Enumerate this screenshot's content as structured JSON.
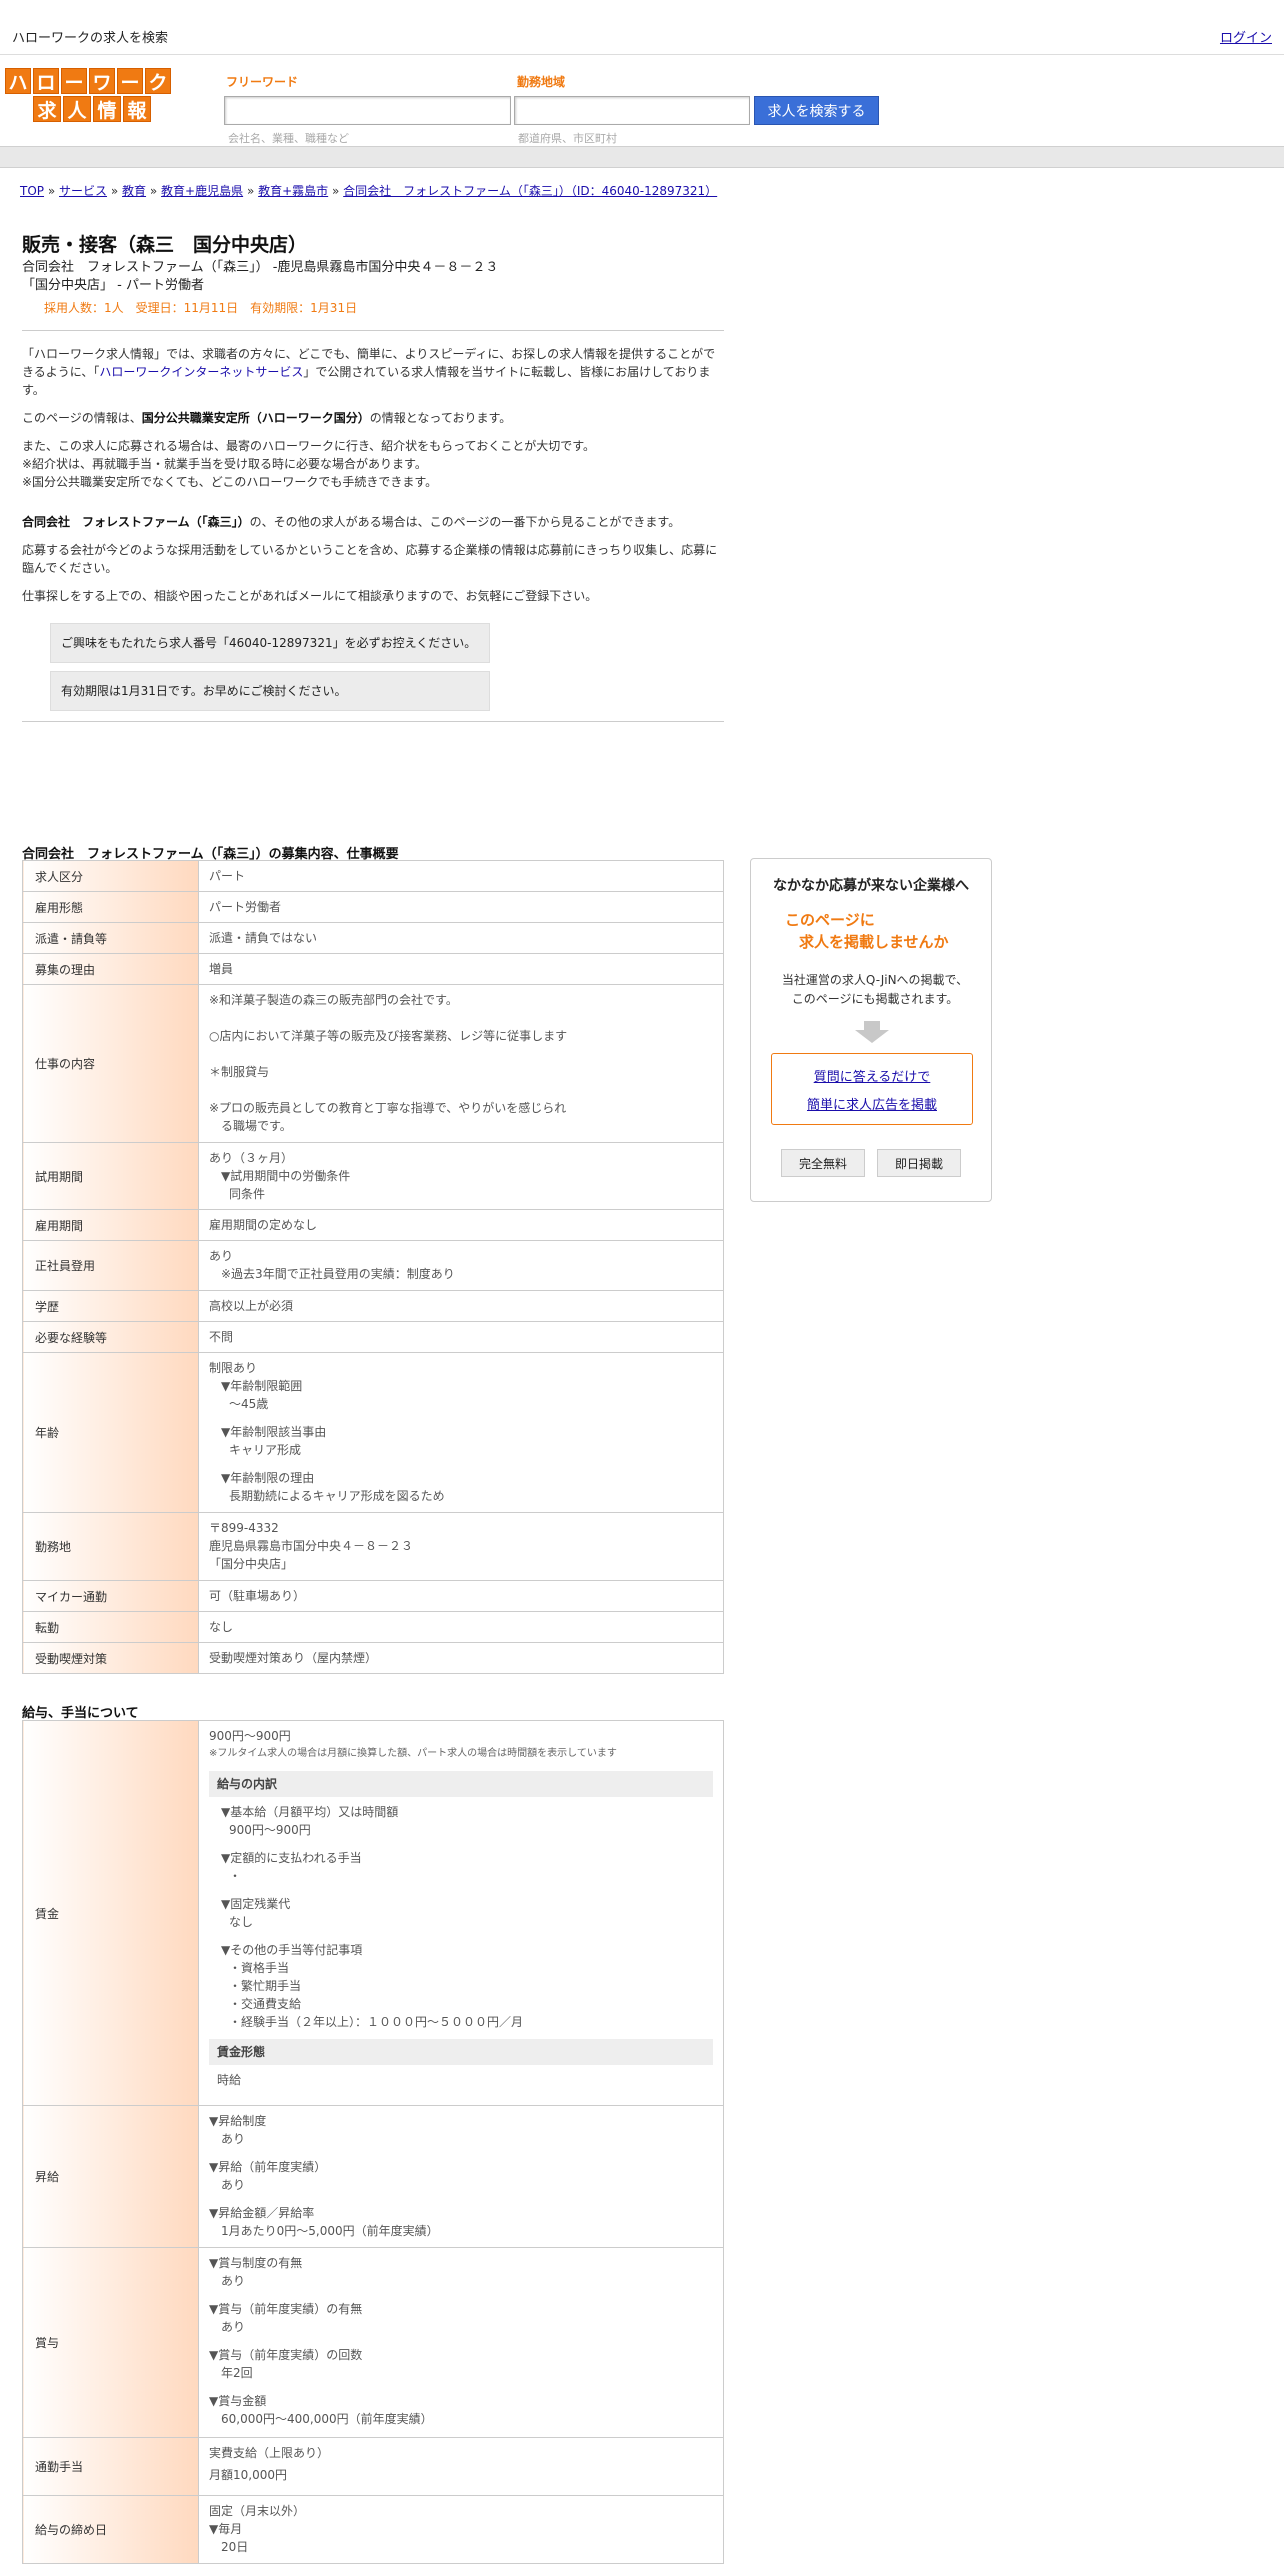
{
  "topbar": {
    "site_title": "ハローワークの求人を検索",
    "login": "ログイン"
  },
  "logo": {
    "row1": [
      "ハ",
      "ロ",
      "ー",
      "ワ",
      "ー",
      "ク"
    ],
    "row2": [
      "求",
      "人",
      "情",
      "報"
    ]
  },
  "search": {
    "keyword_label": "フリーワード",
    "keyword_placeholder": "",
    "keyword_hint": "会社名、業種、職種など",
    "area_label": "勤務地域",
    "area_hint": "都道府県、市区町村",
    "button": "求人を検索する"
  },
  "breadcrumb": [
    "TOP",
    "サービス",
    "教育",
    "教育+鹿児島県",
    "教育+霧島市",
    "合同会社　フォレストファーム（「森三」）（ID：46040-12897321）"
  ],
  "breadcrumb_sep": "»",
  "job": {
    "title": "販売・接客（森三　国分中央店）",
    "company_line": "合同会社　フォレストファーム（「森三」） -鹿児島県霧島市国分中央４－８－２３",
    "store_line": "「国分中央店」 - パート労働者",
    "meta": "採用人数：1人　受理日：11月11日　有効期限：1月31日"
  },
  "intro": {
    "p1_a": "「ハローワーク求人情報」では、求職者の方々に、どこでも、簡単に、よりスピーディに、お探しの求人情報を提供することができるように、「",
    "p1_link": "ハローワークインターネットサービス",
    "p1_b": "」で公開されている求人情報を当サイトに転載し、皆様にお届けしております。",
    "p2_a": "このページの情報は、",
    "p2_b": "国分公共職業安定所（ハローワーク国分）",
    "p2_c": "の情報となっております。",
    "p3_1": "また、この求人に応募される場合は、最寄のハローワークに行き、紹介状をもらっておくことが大切です。",
    "p3_2": "※紹介状は、再就職手当・就業手当を受け取る時に必要な場合があります。",
    "p3_3": "※国分公共職業安定所でなくても、どこのハローワークでも手続きできます。",
    "p4_a": "合同会社　フォレストファーム（「森三」）",
    "p4_b": "の、その他の求人がある場合は、このページの一番下から見ることができます。",
    "p5": "応募する会社が今どのような採用活動をしているかということを含め、応募する企業様の情報は応募前にきっちり収集し、応募に臨んでください。",
    "p6": "仕事探しをする上での、相談や困ったことがあればメールにて相談承りますので、お気軽にご登録下さい。",
    "notice1": "ご興味をもたれたら求人番号「46040-12897321」を必ずお控えください。",
    "notice2": "有効期限は1月31日です。お早めにご検討ください。"
  },
  "section1": {
    "title": "合同会社　フォレストファーム（「森三」）の募集内容、仕事概要",
    "rows": {
      "kubun": {
        "label": "求人区分",
        "value": "パート"
      },
      "keitai": {
        "label": "雇用形態",
        "value": "パート労働者"
      },
      "haken": {
        "label": "派遣・請負等",
        "value": "派遣・請負ではない"
      },
      "riyu": {
        "label": "募集の理由",
        "value": "増員"
      },
      "naiyo": {
        "label": "仕事の内容",
        "l1": "※和洋菓子製造の森三の販売部門の会社です。",
        "l2": "○店内において洋菓子等の販売及び接客業務、レジ等に従事します",
        "l3": "＊制服貸与",
        "l4": "※プロの販売員としての教育と丁寧な指導で、やりがいを感じられ",
        "l5": "る職場です。"
      },
      "shiyo": {
        "label": "試用期間",
        "l1": "あり（３ヶ月）",
        "l2": "▼試用期間中の労働条件",
        "l3": "同条件"
      },
      "koyokikan": {
        "label": "雇用期間",
        "value": "雇用期間の定めなし"
      },
      "seishain": {
        "label": "正社員登用",
        "l1": "あり",
        "l2": "※過去3年間で正社員登用の実績：制度あり"
      },
      "gakureki": {
        "label": "学歴",
        "value": "高校以上が必須"
      },
      "keiken": {
        "label": "必要な経験等",
        "value": "不問"
      },
      "nenrei": {
        "label": "年齢",
        "l1": "制限あり",
        "l2": "▼年齢制限範囲",
        "l3": "〜45歳",
        "l4": "▼年齢制限該当事由",
        "l5": "キャリア形成",
        "l6": "▼年齢制限の理由",
        "l7": "長期勤続によるキャリア形成を図るため"
      },
      "kinmuchi": {
        "label": "勤務地",
        "l1": "〒899-4332",
        "l2": "鹿児島県霧島市国分中央４－８－２３",
        "l3": "「国分中央店」"
      },
      "mycar": {
        "label": "マイカー通勤",
        "value": "可（駐車場あり）"
      },
      "tenkin": {
        "label": "転勤",
        "value": "なし"
      },
      "kitsuen": {
        "label": "受動喫煙対策",
        "value": "受動喫煙対策あり（屋内禁煙）"
      }
    }
  },
  "section2": {
    "title": "給与、手当について",
    "chingin": {
      "label": "賃金",
      "range": "900円〜900円",
      "note": "※フルタイム求人の場合は月額に換算した額、パート求人の場合は時間額を表示しています",
      "uchiwake_head": "給与の内訳",
      "b1": "▼基本給（月額平均）又は時間額",
      "b1v": "900円〜900円",
      "b2": "▼定額的に支払われる手当",
      "b2v": "・",
      "b3": "▼固定残業代",
      "b3v": "なし",
      "b4": "▼その他の手当等付記事項",
      "b4v1": "・資格手当",
      "b4v2": "・繁忙期手当",
      "b4v3": "・交通費支給",
      "b4v4": "・経験手当（２年以上）：１０００円～５０００円／月",
      "keitai_head": "賃金形態",
      "keitai_value": "時給"
    },
    "shokyu": {
      "label": "昇給",
      "l1": "▼昇給制度",
      "l2": "あり",
      "l3": "▼昇給（前年度実績）",
      "l4": "あり",
      "l5": "▼昇給金額／昇給率",
      "l6": "1月あたり0円〜5,000円（前年度実績）"
    },
    "shoyo": {
      "label": "賞与",
      "l1": "▼賞与制度の有無",
      "l2": "あり",
      "l3": "▼賞与（前年度実績）の有無",
      "l4": "あり",
      "l5": "▼賞与（前年度実績）の回数",
      "l6": "年2回",
      "l7": "▼賞与金額",
      "l8": "60,000円〜400,000円（前年度実績）"
    },
    "tsukin": {
      "label": "通勤手当",
      "l1": "実費支給（上限あり）",
      "l2": "月額10,000円"
    },
    "shimebi": {
      "label": "給与の締め日",
      "l1": "固定（月末以外）",
      "l2": "▼毎月",
      "l3": "20日"
    }
  },
  "ad": {
    "title": "なかなか応募が来ない企業様へ",
    "orange1": "このページに",
    "orange2": "求人を掲載しませんか",
    "body1": "当社運営の求人Q-JiNへの掲載で、",
    "body2": "このページにも掲載されます。",
    "link1": "質問に答えるだけで",
    "link2": "簡単に求人広告を掲載",
    "pill1": "完全無料",
    "pill2": "即日掲載",
    "accent": "#f07a12"
  }
}
